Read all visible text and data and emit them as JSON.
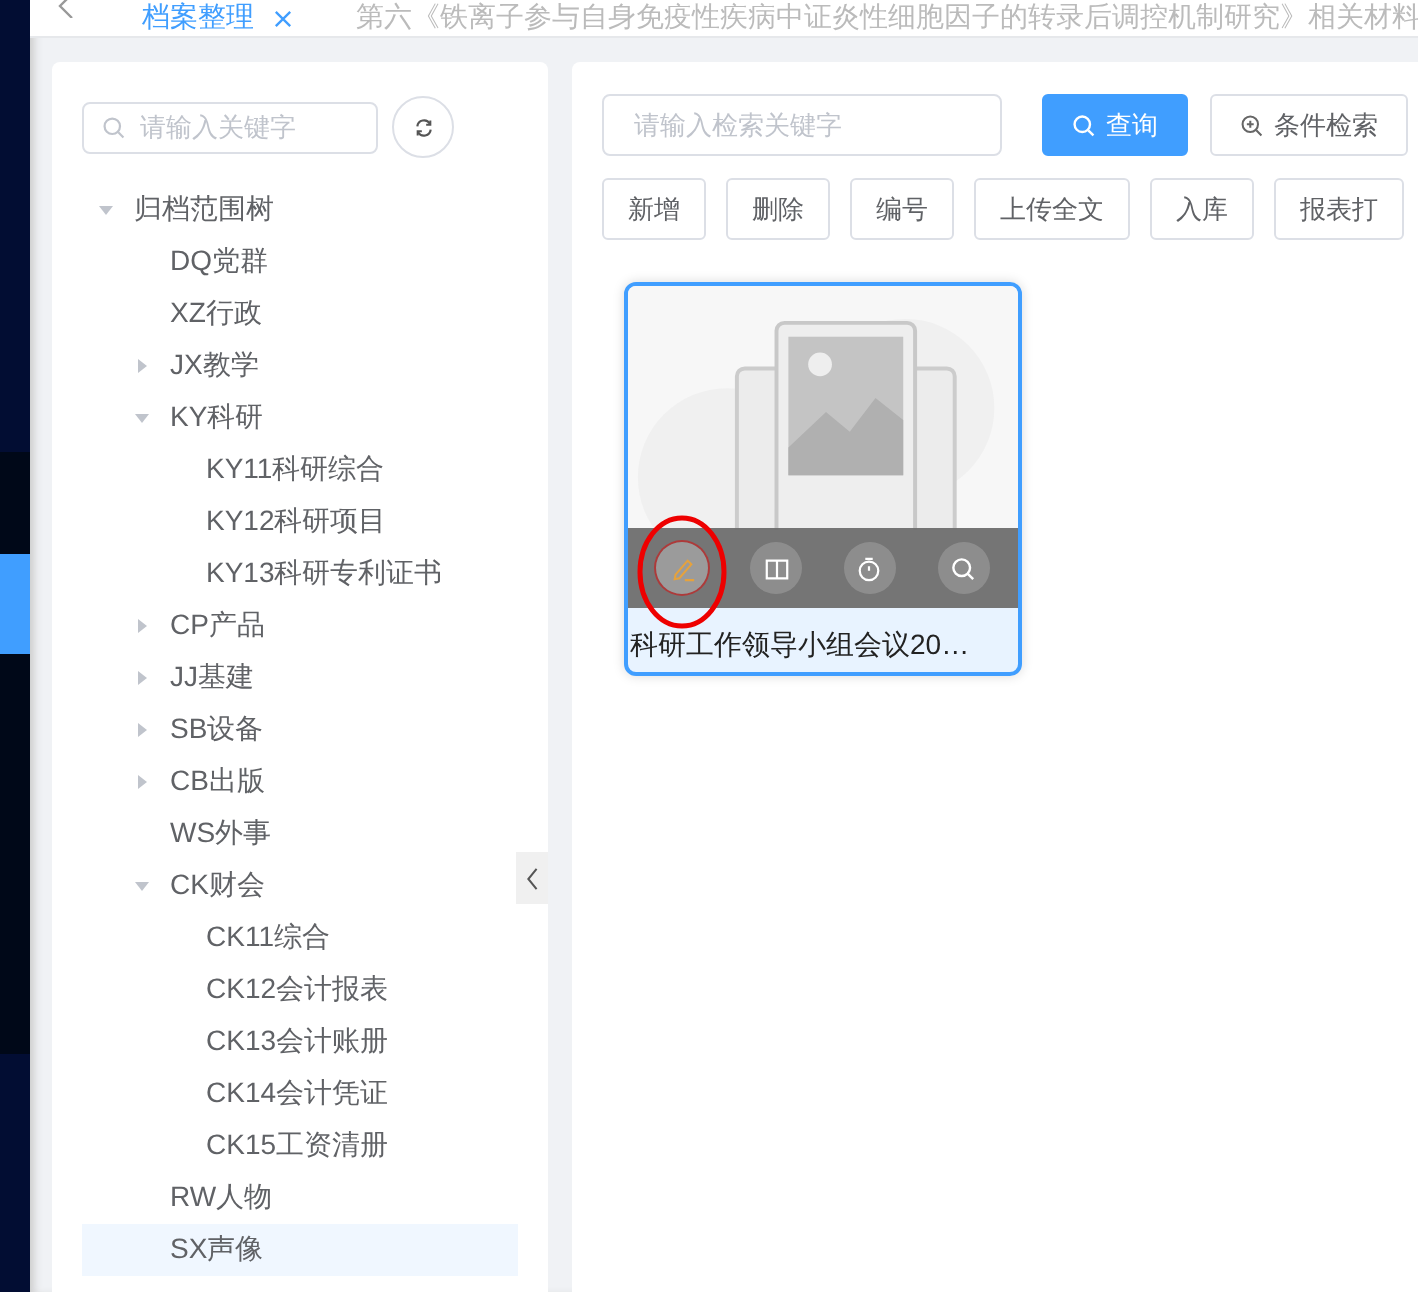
{
  "tabs": [
    {
      "label": "档案整理",
      "selected": true,
      "closable": true
    },
    {
      "label": "第六《铁离子参与自身免疫性疾病中证炎性细胞因子的转录后调控机制研究》相关材料",
      "selected": false,
      "closable": false
    }
  ],
  "tree": {
    "search": {
      "placeholder": "请输入关键字"
    },
    "nodes": [
      {
        "label": "归档范围树",
        "kind": "folder",
        "expanded": true,
        "selected": false,
        "children": [
          {
            "label": "DQ党群",
            "kind": "leaf",
            "expanded": false,
            "selected": false
          },
          {
            "label": "XZ行政",
            "kind": "leaf",
            "expanded": false,
            "selected": false
          },
          {
            "label": "JX教学",
            "kind": "folder",
            "expanded": false,
            "selected": false
          },
          {
            "label": "KY科研",
            "kind": "folder",
            "expanded": true,
            "selected": false,
            "children": [
              {
                "label": "KY11科研综合",
                "kind": "leaf",
                "expanded": false,
                "selected": false
              },
              {
                "label": "KY12科研项目",
                "kind": "leaf",
                "expanded": false,
                "selected": false
              },
              {
                "label": "KY13科研专利证书",
                "kind": "leaf",
                "expanded": false,
                "selected": false
              }
            ]
          },
          {
            "label": "CP产品",
            "kind": "folder",
            "expanded": false,
            "selected": false
          },
          {
            "label": "JJ基建",
            "kind": "folder",
            "expanded": false,
            "selected": false
          },
          {
            "label": "SB设备",
            "kind": "folder",
            "expanded": false,
            "selected": false
          },
          {
            "label": "CB出版",
            "kind": "folder",
            "expanded": false,
            "selected": false
          },
          {
            "label": "WS外事",
            "kind": "leaf",
            "expanded": false,
            "selected": false
          },
          {
            "label": "CK财会",
            "kind": "folder",
            "expanded": true,
            "selected": false,
            "children": [
              {
                "label": "CK11综合",
                "kind": "leaf",
                "expanded": false,
                "selected": false
              },
              {
                "label": "CK12会计报表",
                "kind": "leaf",
                "expanded": false,
                "selected": false
              },
              {
                "label": "CK13会计账册",
                "kind": "leaf",
                "expanded": false,
                "selected": false
              },
              {
                "label": "CK14会计凭证",
                "kind": "leaf",
                "expanded": false,
                "selected": false
              },
              {
                "label": "CK15工资清册",
                "kind": "leaf",
                "expanded": false,
                "selected": false
              }
            ]
          },
          {
            "label": "RW人物",
            "kind": "leaf",
            "expanded": false,
            "selected": false
          },
          {
            "label": "SX声像",
            "kind": "leaf",
            "expanded": false,
            "selected": true
          }
        ]
      }
    ]
  },
  "search": {
    "placeholder": "请输入检索关键字"
  },
  "search_buttons": [
    {
      "label": "查询",
      "kind": "primary"
    },
    {
      "label": "条件检索",
      "kind": "advanced"
    }
  ],
  "toolbar": [
    "新增",
    "删除",
    "编号",
    "上传全文",
    "入库",
    "报表打"
  ],
  "cards": [
    {
      "title": "科研工作领导小组会议20…",
      "selected": true,
      "actions": [
        {
          "kind": "edit",
          "highlighted": true
        },
        {
          "kind": "read",
          "highlighted": false
        },
        {
          "kind": "timer",
          "highlighted": false
        },
        {
          "kind": "search",
          "highlighted": false
        }
      ]
    }
  ]
}
